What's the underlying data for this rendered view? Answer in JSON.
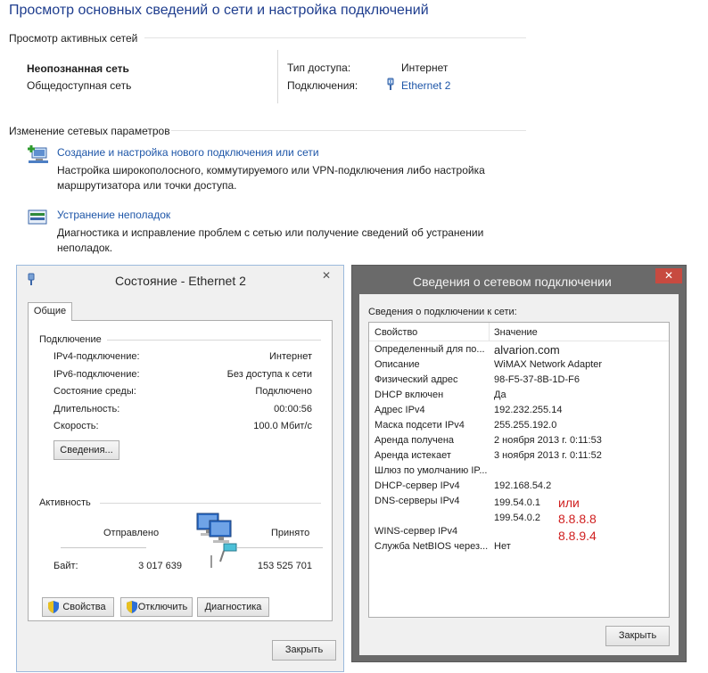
{
  "main": {
    "title": "Просмотр основных сведений о сети и настройка подключений",
    "active_networks_label": "Просмотр активных сетей",
    "network_name": "Неопознанная сеть",
    "network_type": "Общедоступная сеть",
    "access_type_label": "Тип доступа:",
    "access_type_value": "Интернет",
    "connections_label": "Подключения:",
    "connections_value": "Ethernet 2",
    "change_settings_label": "Изменение сетевых параметров",
    "create_link": "Создание и настройка нового подключения или сети",
    "create_desc_1": "Настройка широкополосного, коммутируемого или VPN-подключения либо настройка",
    "create_desc_2": "маршрутизатора или точки доступа.",
    "troubleshoot_link": "Устранение неполадок",
    "troubleshoot_desc_1": "Диагностика и исправление проблем с сетью или получение сведений об устранении",
    "troubleshoot_desc_2": "неполадок."
  },
  "status_dialog": {
    "title": "Состояние - Ethernet 2",
    "close_glyph": "✕",
    "tab": "Общие",
    "connection_group": "Подключение",
    "rows": [
      {
        "label": "IPv4-подключение:",
        "value": "Интернет"
      },
      {
        "label": "IPv6-подключение:",
        "value": "Без доступа к сети"
      },
      {
        "label": "Состояние среды:",
        "value": "Подключено"
      },
      {
        "label": "Длительность:",
        "value": "00:00:56"
      },
      {
        "label": "Скорость:",
        "value": "100.0 Мбит/с"
      }
    ],
    "details_button": "Сведения...",
    "activity_group": "Активность",
    "sent_label": "Отправлено",
    "received_label": "Принято",
    "bytes_label": "Байт:",
    "bytes_sent": "3 017 639",
    "bytes_received": "153 525 701",
    "properties_button": "Свойства",
    "disconnect_button": "Отключить",
    "diagnostics_button": "Диагностика",
    "close_button": "Закрыть"
  },
  "details_dialog": {
    "title": "Сведения о сетевом подключении",
    "close_glyph": "✕",
    "section_label": "Сведения о подключении к сети:",
    "col_property": "Свойство",
    "col_value": "Значение",
    "rows": [
      {
        "property": "Определенный для по...",
        "value": "alvarion.com"
      },
      {
        "property": "Описание",
        "value": "WiMAX Network Adapter"
      },
      {
        "property": "Физический адрес",
        "value": "98-F5-37-8B-1D-F6"
      },
      {
        "property": "DHCP включен",
        "value": "Да"
      },
      {
        "property": "Адрес IPv4",
        "value": "192.232.255.14"
      },
      {
        "property": "Маска подсети IPv4",
        "value": "255.255.192.0"
      },
      {
        "property": "Аренда получена",
        "value": "2 ноября 2013 г. 0:11:53"
      },
      {
        "property": "Аренда истекает",
        "value": "3 ноября 2013 г. 0:11:52"
      },
      {
        "property": "Шлюз по умолчанию IP...",
        "value": ""
      },
      {
        "property": "DHCP-сервер IPv4",
        "value": "192.168.54.2"
      },
      {
        "property": "DNS-серверы IPv4",
        "value": "199.54.0.1"
      },
      {
        "property": "",
        "value": "199.54.0.2"
      },
      {
        "property": "WINS-сервер IPv4",
        "value": ""
      },
      {
        "property": "Служба NetBIOS через...",
        "value": "Нет"
      }
    ],
    "annotation_or": "или",
    "annotation_dns1": "8.8.8.8",
    "annotation_dns2": "8.8.9.4",
    "close_button": "Закрыть"
  },
  "colors": {
    "title": "#1e3d8e",
    "link": "#1e56a8",
    "annotation": "#d02020",
    "close_red": "#c74a40"
  }
}
